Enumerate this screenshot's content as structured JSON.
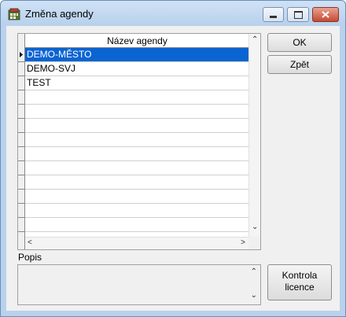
{
  "window": {
    "title": "Změna agendy",
    "icons": {
      "app": "app-icon",
      "minimize": "minimize-icon",
      "maximize": "maximize-icon",
      "close": "close-icon"
    }
  },
  "grid": {
    "column_header": "Název agendy",
    "selected_index": 0,
    "rows": [
      "DEMO-MĚSTO",
      "DEMO-SVJ",
      "TEST",
      "",
      "",
      "",
      "",
      "",
      "",
      "",
      "",
      "",
      ""
    ]
  },
  "buttons": {
    "ok": "OK",
    "back": "Zpět",
    "license_line1": "Kontrola",
    "license_line2": "licence"
  },
  "description": {
    "label": "Popis",
    "value": ""
  },
  "scroll_glyphs": {
    "up": "⌃",
    "down": "⌄",
    "left": "<",
    "right": ">"
  },
  "colors": {
    "selection": "#0a64d2",
    "titlebar": "#b9d1ec",
    "close": "#c44a32"
  }
}
